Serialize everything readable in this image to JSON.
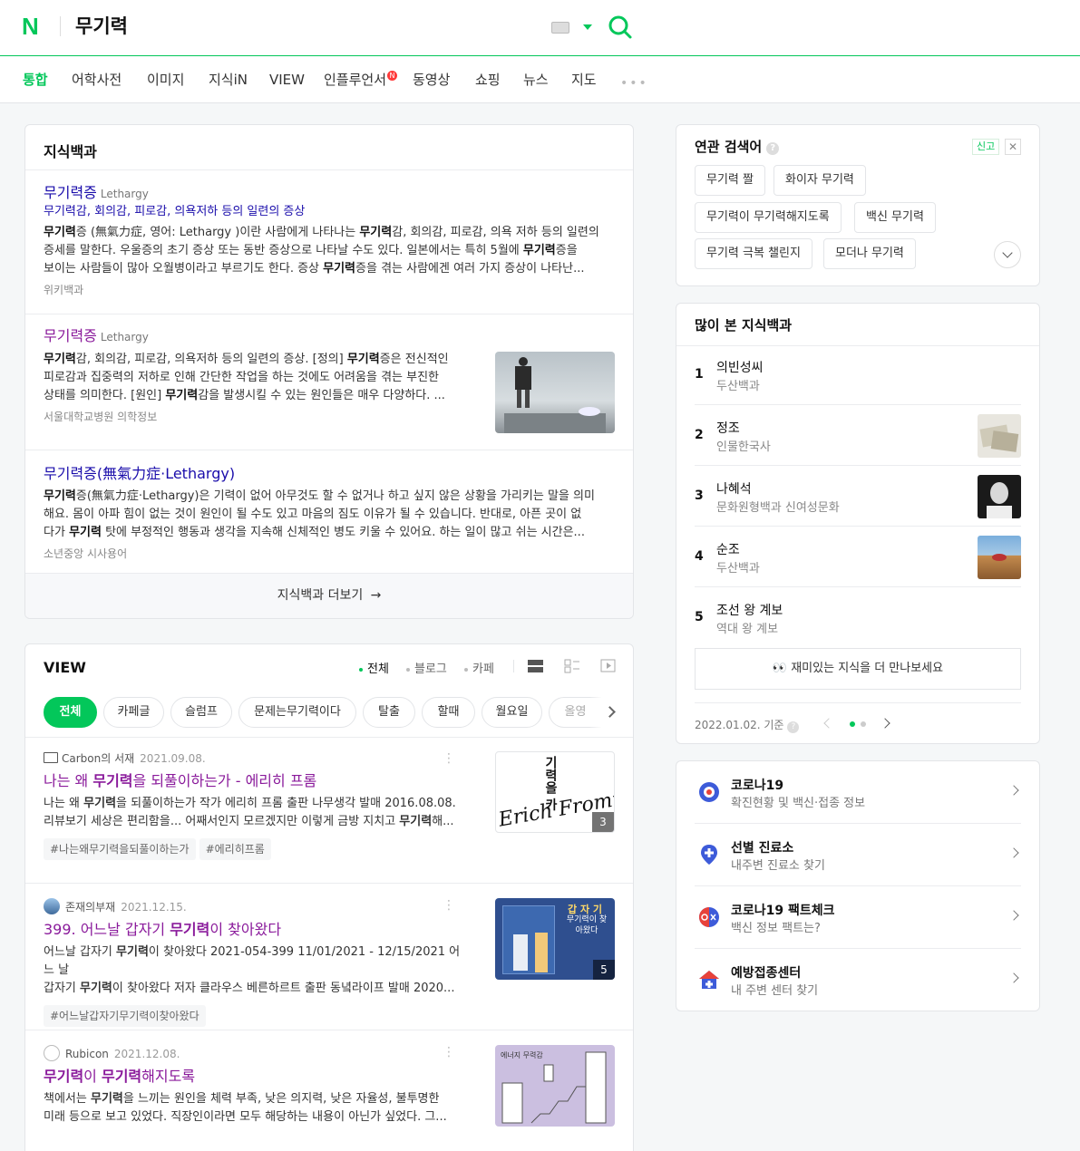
{
  "header": {
    "logo": "N",
    "query": "무기력"
  },
  "tabs": [
    {
      "label": "통합",
      "active": true
    },
    {
      "label": "어학사전"
    },
    {
      "label": "이미지"
    },
    {
      "label": "지식iN"
    },
    {
      "label": "VIEW"
    },
    {
      "label": "인플루언서",
      "badge": "N"
    },
    {
      "label": "동영상"
    },
    {
      "label": "쇼핑"
    },
    {
      "label": "뉴스"
    },
    {
      "label": "지도"
    }
  ],
  "knowledge": {
    "title": "지식백과",
    "items": [
      {
        "title": "무기력증",
        "eng": "Lethargy",
        "sub": "무기력감, 회의감, 피로감, 의욕저하 등의 일련의 증상",
        "desc_line1_html": "<b>무기력</b>증 (無氣力症, 영어: Lethargy )이란 사람에게 나타나는 <b>무기력</b>감, 회의감, 피로감, 의욕 저하 등의 일련의",
        "desc_line2_html": "증세를 말한다. 우울증의 초기 증상 또는 동반 증상으로 나타날 수도 있다. 일본에서는 특히 5월에 <b>무기력</b>증을",
        "desc_line3_html": "보이는 사람들이 많아 오월병이라고 부르기도 한다. 증상 <b>무기력</b>증을 겪는 사람에겐 여러 가지 증상이 나타난...",
        "source": "위키백과"
      },
      {
        "title": "무기력증",
        "eng": "Lethargy",
        "desc_line1_html": "<b>무기력</b>감, 회의감, 피로감, 의욕저하 등의 일련의 증상. [정의] <b>무기력</b>증은 전신적인",
        "desc_line2_html": "피로감과 집중력의 저하로 인해 간단한 작업을 하는 것에도 어려움을 겪는 부진한",
        "desc_line3_html": "상태를 의미한다. [원인] <b>무기력</b>감을 발생시킬 수 있는 원인들은 매우 다양하다. ...",
        "source": "서울대학교병원 의학정보"
      },
      {
        "title": "무기력증(無氣力症·Lethargy)",
        "desc_line1_html": "<b>무기력</b>증(無氣力症·Lethargy)은 기력이 없어 아무것도 할 수 없거나 하고 싶지 않은 상황을 가리키는 말을 의미",
        "desc_line2_html": "해요. 몸이 아파 힘이 없는 것이 원인이 될 수도 있고 마음의 짐도 이유가 될 수 있습니다. 반대로, 아픈 곳이 없",
        "desc_line3_html": "다가 <b>무기력</b> 탓에 부정적인 행동과 생각을 지속해 신체적인 병도 키울 수 있어요. 하는 일이 많고 쉬는 시간은...",
        "source": "소년중앙 시사용어"
      }
    ],
    "more_label": "지식백과 더보기"
  },
  "view": {
    "title": "VIEW",
    "filters": [
      "전체",
      "블로그",
      "카페"
    ],
    "chips": [
      "전체",
      "카페글",
      "슬럼프",
      "문제는무기력이다",
      "탈출",
      "할때",
      "월요일",
      "올영"
    ],
    "posts": [
      {
        "author": "Carbon의 서재",
        "date": "2021.09.08.",
        "title_html": "나는 왜 <b>무기력</b>을 되풀이하는가 - 에리히 프롬",
        "desc_line1_html": "나는 왜 <b>무기력</b>을 되풀이하는가 작가 에리히 프롬 출판 나무생각 발매 2016.08.08.",
        "desc_line2_html": "리뷰보기 세상은 편리함을... 어째서인지 모르겠지만 이렇게 금방 지치고 <b>무기력</b>해...",
        "tags": [
          "#나는왜무기력을되풀이하는가",
          "#에리히프롬"
        ],
        "count": "3",
        "thumb_text_top": "기력을 카",
        "thumb_text": "Erich Fromm"
      },
      {
        "author": "존재의부재",
        "date": "2021.12.15.",
        "title_html": "399. 어느날 갑자기 <b>무기력</b>이 찾아왔다",
        "desc_line1_html": "어느날 갑자기 <b>무기력</b>이 찾아왔다 2021-054-399 11/01/2021 - 12/15/2021 어느 날",
        "desc_line2_html": "갑자기 <b>무기력</b>이 찾아왔다 저자 클라우스 베른하르트 출판 동녘라이프 발매 2020...",
        "tags": [
          "#어느날갑자기무기력이찾아왔다"
        ],
        "count": "5",
        "thumb_text_top": "갑 자 기",
        "thumb_text": "무기력이 찾아왔다"
      },
      {
        "author": "Rubicon",
        "date": "2021.12.08.",
        "title_html": "<b>무기력</b>이 <b>무기력</b>해지도록",
        "desc_line1_html": "책에서는 <b>무기력</b>을 느끼는 원인을 체력 부족, 낮은 의지력, 낮은 자율성, 불투명한",
        "desc_line2_html": "미래 등으로 보고 있었다. 직장인이라면 모두 해당하는 내용이 아닌가 싶었다. 그...",
        "tags": [],
        "thumb_text": "에너지 무력감"
      }
    ]
  },
  "related": {
    "title": "연관 검색어",
    "report": "신고",
    "chips": [
      "무기력 짤",
      "화이자 무기력",
      "무기력이 무기력해지도록",
      "백신 무기력",
      "무기력 극복 챌린지",
      "모더나 무기력"
    ]
  },
  "popular": {
    "title": "많이 본 지식백과",
    "items": [
      {
        "num": "1",
        "name": "의빈성씨",
        "source": "두산백과"
      },
      {
        "num": "2",
        "name": "정조",
        "source": "인물한국사"
      },
      {
        "num": "3",
        "name": "나혜석",
        "source": "문화원형백과 신여성문화"
      },
      {
        "num": "4",
        "name": "순조",
        "source": "두산백과"
      },
      {
        "num": "5",
        "name": "조선 왕 계보",
        "source": "역대 왕 계보"
      }
    ],
    "cta_emoji": "👀",
    "cta": "재미있는 지식을 더 만나보세요",
    "basis": "2022.01.02. 기준"
  },
  "services": [
    {
      "name": "코로나19",
      "sub": "확진현황 및 백신·접종 정보",
      "icon": "covid-icon"
    },
    {
      "name": "선별 진료소",
      "sub": "내주변 진료소 찾기",
      "icon": "clinic-pin-icon"
    },
    {
      "name": "코로나19 팩트체크",
      "sub": "백신 정보 팩트는?",
      "icon": "factcheck-icon"
    },
    {
      "name": "예방접종센터",
      "sub": "내 주변 센터 찾기",
      "icon": "vaccine-center-icon"
    }
  ],
  "colors": {
    "accent": "#03c75a",
    "link": "#1a0dab",
    "visited": "#8a1a9b"
  }
}
